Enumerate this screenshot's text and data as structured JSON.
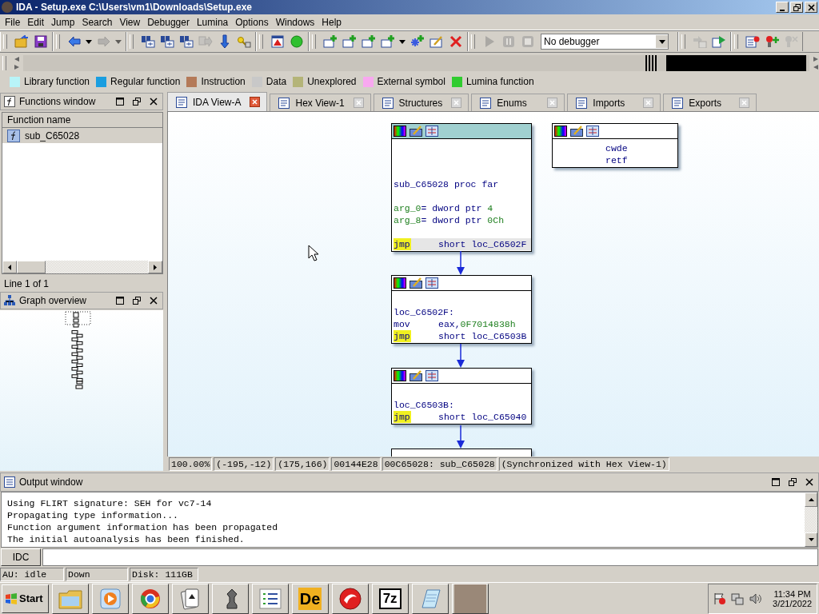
{
  "window": {
    "title": "IDA - Setup.exe C:\\Users\\vm1\\Downloads\\Setup.exe"
  },
  "menu": [
    "File",
    "Edit",
    "Jump",
    "Search",
    "View",
    "Debugger",
    "Lumina",
    "Options",
    "Windows",
    "Help"
  ],
  "toolbar": {
    "groups": [
      {
        "items": [
          {
            "kind": "folder",
            "disabled": false
          },
          {
            "kind": "save",
            "disabled": false
          }
        ]
      },
      {
        "items": [
          {
            "kind": "back",
            "disabled": false
          },
          {
            "kind": "caret",
            "disabled": false
          },
          {
            "kind": "forward",
            "disabled": true
          },
          {
            "kind": "caret",
            "disabled": true
          }
        ]
      },
      {
        "items": [
          {
            "kind": "binoculars",
            "disabled": false
          },
          {
            "kind": "binoculars",
            "disabled": false
          },
          {
            "kind": "binoculars",
            "disabled": false
          },
          {
            "kind": "jump",
            "disabled": true
          },
          {
            "kind": "down",
            "disabled": false
          },
          {
            "kind": "key",
            "disabled": false
          }
        ]
      },
      {
        "items": [
          {
            "kind": "warning",
            "disabled": false
          },
          {
            "kind": "circle",
            "disabled": false
          }
        ]
      },
      {
        "items": [
          {
            "kind": "add",
            "disabled": false
          },
          {
            "kind": "add",
            "disabled": false
          },
          {
            "kind": "add",
            "disabled": false
          },
          {
            "kind": "add",
            "disabled": false
          },
          {
            "kind": "caret",
            "disabled": false
          },
          {
            "kind": "star",
            "disabled": false
          },
          {
            "kind": "edit",
            "disabled": false
          },
          {
            "kind": "delete",
            "disabled": false
          }
        ]
      },
      {
        "items": [
          {
            "kind": "play",
            "disabled": true
          },
          {
            "kind": "pause",
            "disabled": true
          },
          {
            "kind": "stop",
            "disabled": true
          },
          {
            "kind": "select",
            "value": "No debugger"
          }
        ]
      },
      {
        "items": [
          {
            "kind": "cstep",
            "disabled": true
          },
          {
            "kind": "crun",
            "disabled": false
          }
        ]
      },
      {
        "items": [
          {
            "kind": "bplist",
            "disabled": false
          },
          {
            "kind": "bpadd",
            "disabled": false
          },
          {
            "kind": "bpdel",
            "disabled": true
          }
        ]
      }
    ]
  },
  "legend": [
    {
      "label": "Library function",
      "color": "#b8f4f8"
    },
    {
      "label": "Regular function",
      "color": "#1a9ee0"
    },
    {
      "label": "Instruction",
      "color": "#b47a58"
    },
    {
      "label": "Data",
      "color": "#c8c8c8"
    },
    {
      "label": "Unexplored",
      "color": "#b4b478"
    },
    {
      "label": "External symbol",
      "color": "#f8a8f0"
    },
    {
      "label": "Lumina function",
      "color": "#30cc30"
    }
  ],
  "functions_window": {
    "title": "Functions window",
    "column": "Function name",
    "items": [
      {
        "name": "sub_C65028",
        "selected": true
      }
    ],
    "status": "Line 1 of 1"
  },
  "graph_overview": {
    "title": "Graph overview"
  },
  "tabs": [
    {
      "label": "IDA View-A",
      "selected": true
    },
    {
      "label": "Hex View-1",
      "selected": false
    },
    {
      "label": "Structures",
      "selected": false
    },
    {
      "label": "Enums",
      "selected": false
    },
    {
      "label": "Imports",
      "selected": false
    },
    {
      "label": "Exports",
      "selected": false
    }
  ],
  "graph": {
    "nodes": [
      {
        "selected": true,
        "lines": [
          {
            "kind": "blank"
          },
          {
            "kind": "blank"
          },
          {
            "kind": "blank"
          },
          {
            "kind": "label",
            "text": "sub_C65028 proc far"
          },
          {
            "kind": "blank"
          },
          {
            "kind": "arg",
            "name": "arg_0",
            "type": "= dword ptr",
            "value": "4"
          },
          {
            "kind": "arg",
            "name": "arg_8",
            "type": "= dword ptr",
            "value": "0Ch"
          },
          {
            "kind": "blank"
          },
          {
            "kind": "instr",
            "mnemonic": "jmp",
            "operand": "short loc_C6502F",
            "highlight": true,
            "current": true
          }
        ]
      },
      {
        "selected": false,
        "lines": [
          {
            "kind": "bare",
            "mnemonic": "cwde"
          },
          {
            "kind": "bare",
            "mnemonic": "retf"
          }
        ]
      },
      {
        "selected": false,
        "lines": [
          {
            "kind": "blank"
          },
          {
            "kind": "label",
            "text": "loc_C6502F:"
          },
          {
            "kind": "instr",
            "mnemonic": "mov",
            "operand": "eax,",
            "number": "0F7014838h",
            "highlight": false,
            "current": false
          },
          {
            "kind": "instr",
            "mnemonic": "jmp",
            "operand": "short loc_C6503B",
            "highlight": true,
            "current": false
          }
        ]
      },
      {
        "selected": false,
        "lines": [
          {
            "kind": "blank"
          },
          {
            "kind": "label",
            "text": "loc_C6503B:"
          },
          {
            "kind": "instr",
            "mnemonic": "jmp",
            "operand": "short loc_C65040",
            "highlight": true,
            "current": false
          }
        ]
      }
    ]
  },
  "graph_status": [
    "100.00%",
    "(-195,-12)",
    "(175,166)",
    "00144E28",
    "00C65028: sub_C65028",
    "(Synchronized with Hex View-1)"
  ],
  "output": {
    "title": "Output window",
    "lines": [
      "Using FLIRT signature: SEH for vc7-14",
      "Propagating type information...",
      "Function argument information has been propagated",
      "The initial autoanalysis has been finished."
    ],
    "command_button": "IDC"
  },
  "status_bar": [
    "AU:  idle",
    "Down",
    "Disk: 111GB"
  ],
  "taskbar": {
    "start": "Start",
    "apps": [
      {
        "kind": "folder"
      },
      {
        "kind": "media"
      },
      {
        "kind": "browser"
      },
      {
        "kind": "cards"
      },
      {
        "kind": "chess"
      },
      {
        "kind": "list"
      },
      {
        "kind": "text",
        "label": "De"
      },
      {
        "kind": "red"
      },
      {
        "kind": "boxed",
        "label": "7z"
      },
      {
        "kind": "notepad"
      },
      {
        "kind": "photo"
      }
    ],
    "time": "11:34 PM",
    "date": "3/21/2022"
  }
}
